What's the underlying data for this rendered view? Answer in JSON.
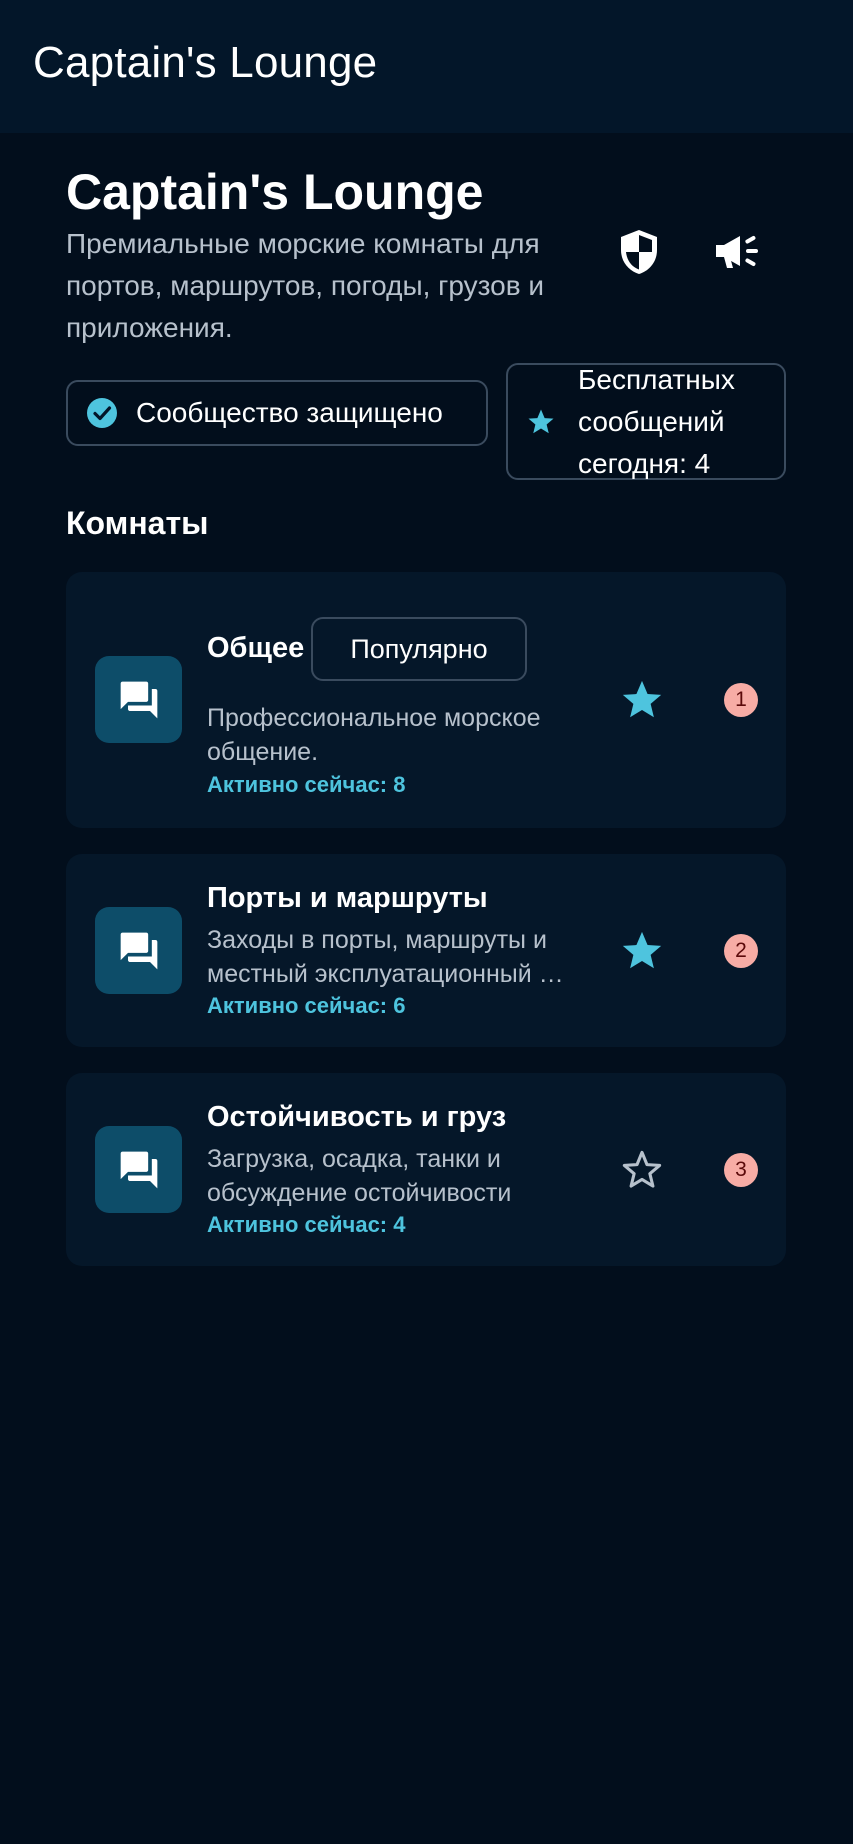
{
  "app_bar": {
    "title": "Captain's Lounge"
  },
  "header": {
    "title": "Captain's Lounge",
    "subtitle": "Премиальные морские комнаты для портов, маршрутов, погоды, грузов и приложения.",
    "icons": [
      "shield-icon",
      "campaign-icon"
    ]
  },
  "chips": {
    "secure": {
      "label": "Сообщество защищено",
      "icon": "check-circle-icon"
    },
    "free": {
      "label": "Бесплатных сообщений сегодня: 4",
      "icon": "star-icon"
    }
  },
  "section": {
    "title": "Комнаты"
  },
  "rooms": [
    {
      "name": "Общее",
      "tag": "Популярно",
      "desc_line1": "Профессиональное морское",
      "desc_line2": "общение.",
      "active": "Активно сейчас: 8",
      "starred": true,
      "rank": "1"
    },
    {
      "name": "Порты и маршруты",
      "desc_line1": "Заходы в порты, маршруты и",
      "desc_line2": "местный эксплуатационный опыт",
      "active": "Активно сейчас: 6",
      "starred": true,
      "rank": "2"
    },
    {
      "name": "Остойчивость и груз",
      "desc_line1": "Загрузка, осадка, танки и",
      "desc_line2": "обсуждение остойчивости",
      "active": "Активно сейчас: 4",
      "starred": false,
      "rank": "3"
    }
  ],
  "colors": {
    "background": "#020e1c",
    "app_bar": "#031629",
    "card": "#051729",
    "accent": "#4ec4de",
    "icon_tile": "#0d4d69",
    "badge": "#f7aca5"
  }
}
